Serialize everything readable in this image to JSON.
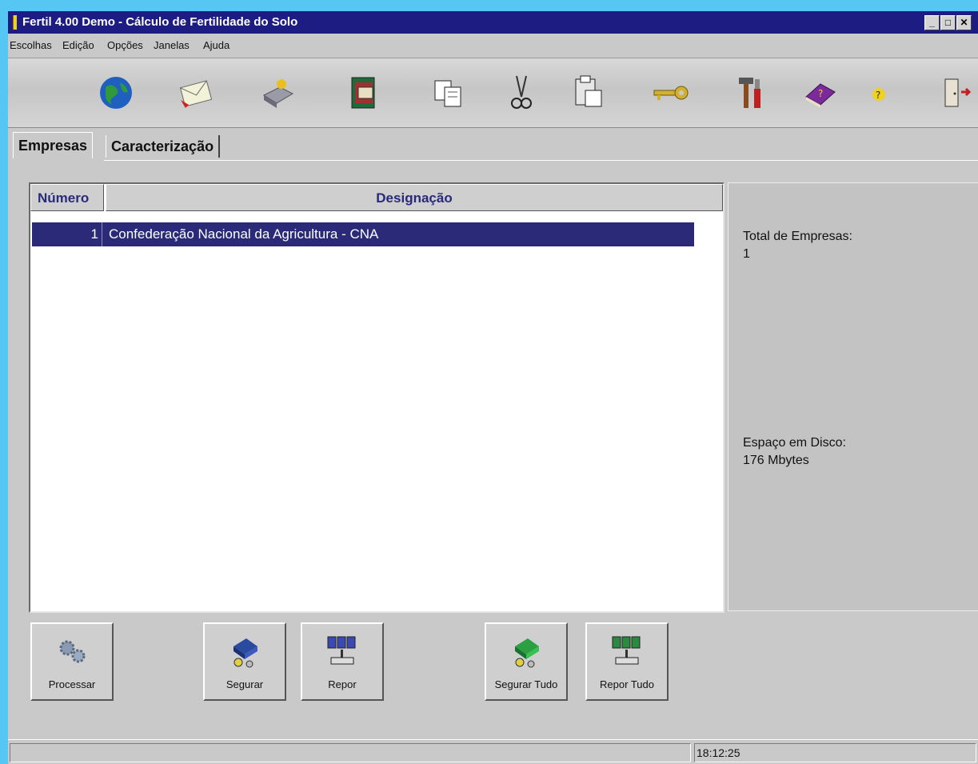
{
  "window": {
    "title": "Fertil 4.00 Demo - Cálculo de Fertilidade do Solo",
    "controls": [
      "minimize-icon",
      "maximize-icon",
      "close-icon"
    ]
  },
  "menu": {
    "items": [
      "Escolhas",
      "Edição",
      "Opções",
      "Janelas",
      "Ajuda"
    ]
  },
  "toolbar": {
    "icons": [
      "globe-icon",
      "envelope-icon",
      "disk-icon",
      "archive-icon",
      "copy-icon",
      "scissors-icon",
      "paste-icon",
      "key-icon",
      "tools-icon",
      "book-icon",
      "help-icon",
      "exit-door-icon"
    ]
  },
  "tabs": [
    {
      "label": "Empresas",
      "active": true
    },
    {
      "label": "Caracterização",
      "active": false
    }
  ],
  "grid": {
    "columns": [
      "Número",
      "Designação"
    ],
    "rows": [
      {
        "numero": "1",
        "designacao": "Confederação Nacional da Agricultura - CNA",
        "selected": true
      }
    ]
  },
  "info": {
    "total_label": "Total de Empresas:",
    "total_value": "1",
    "disk_label": "Espaço em Disco:",
    "disk_value": "176 Mbytes"
  },
  "buttons": {
    "processar": "Processar",
    "segurar": "Segurar",
    "repor": "Repor",
    "segurar_tudo": "Segurar Tudo",
    "repor_tudo": "Repor Tudo"
  },
  "status": {
    "time": "18:12:25"
  },
  "colors": {
    "titlebar": "#1c1c82",
    "selection": "#2a2a78",
    "header_text": "#2a2a7a",
    "background": "#56c6f2"
  }
}
